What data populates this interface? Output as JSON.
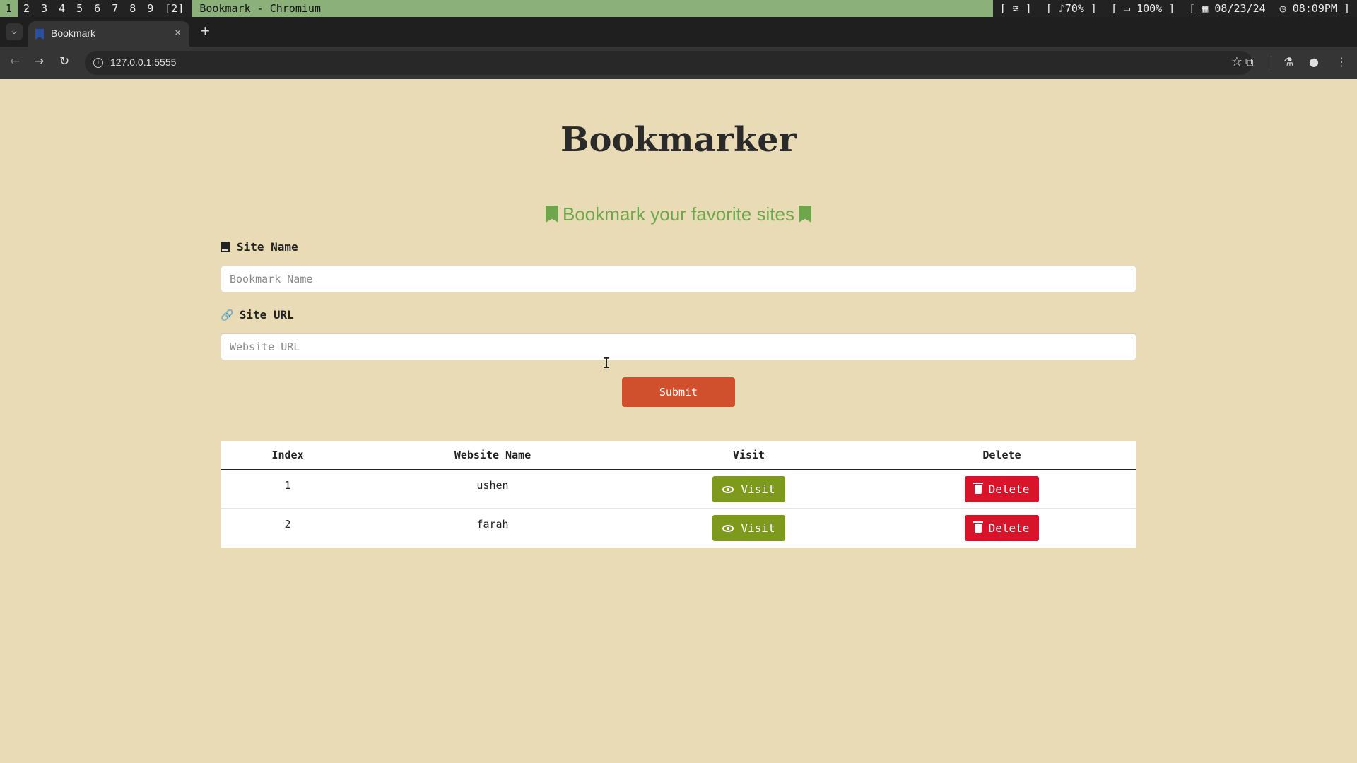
{
  "statusbar": {
    "workspaces": [
      "1",
      "2",
      "3",
      "4",
      "5",
      "6",
      "7",
      "8",
      "9",
      "[2]"
    ],
    "active_workspace": "1",
    "window_title": "Bookmark - Chromium",
    "wifi": "[ ≋ ]",
    "volume": "[ ♪70% ]",
    "battery": "[ ▭ 100% ]",
    "date": "[ ▦ 08/23/24",
    "time": "◷ 08:09PM ]"
  },
  "browser": {
    "tab_title": "Bookmark",
    "tab_close": "×",
    "new_tab": "+",
    "url": "127.0.0.1:5555",
    "back": "←",
    "forward": "→",
    "reload": "↻",
    "star": "☆",
    "extensions": "⧉",
    "labs": "⚗",
    "profile": "●",
    "menu": "⋮"
  },
  "page": {
    "title": "Bookmarker",
    "subtitle": "Bookmark your favorite sites",
    "site_name_label": "Site Name",
    "site_name_placeholder": "Bookmark Name",
    "site_url_label": "Site URL",
    "site_url_placeholder": "Website URL",
    "submit_label": "Submit"
  },
  "table": {
    "headers": [
      "Index",
      "Website Name",
      "Visit",
      "Delete"
    ],
    "rows": [
      {
        "index": "1",
        "name": "ushen",
        "visit": "Visit",
        "delete": "Delete"
      },
      {
        "index": "2",
        "name": "farah",
        "visit": "Visit",
        "delete": "Delete"
      }
    ]
  },
  "colors": {
    "background": "#e9dbb5",
    "accent_green": "#6fa64b",
    "submit": "#d04f2c",
    "visit": "#7d9a1d",
    "delete": "#d7142a"
  },
  "icons": {
    "site_name": "book-icon",
    "site_url": "link-icon",
    "subtitle": "bookmark-icon",
    "visit": "eye-icon",
    "delete": "trash-icon"
  }
}
